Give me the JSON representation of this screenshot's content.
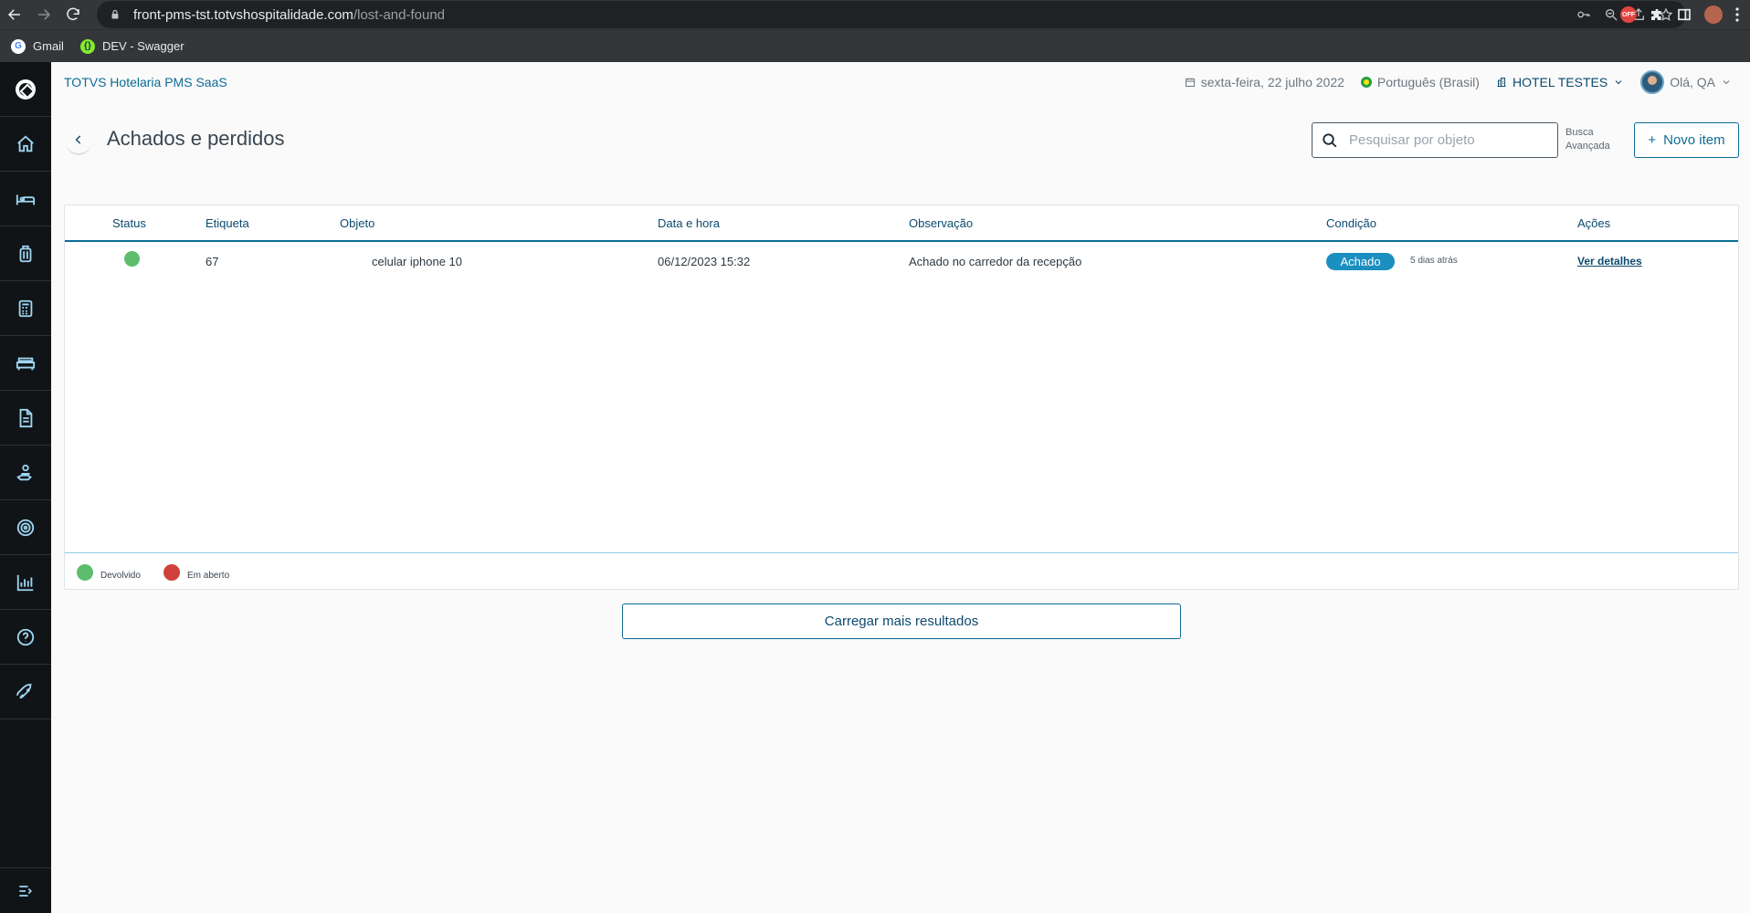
{
  "browser": {
    "url_host": "front-pms-tst.totvshospitalidade.com",
    "url_path": "/lost-and-found",
    "bookmarks": [
      {
        "label": "Gmail"
      },
      {
        "label": "DEV - Swagger"
      }
    ]
  },
  "app": {
    "title": "TOTVS Hotelaria PMS SaaS",
    "date": "sexta-feira, 22 julho 2022",
    "language": "Português (Brasil)",
    "hotel": "HOTEL TESTES",
    "greeting": "Olá, QA"
  },
  "page": {
    "title": "Achados e perdidos",
    "search_placeholder": "Pesquisar por objeto",
    "advanced_search": "Busca Avançada",
    "new_item": "Novo item",
    "load_more": "Carregar mais resultados"
  },
  "table": {
    "headers": {
      "status": "Status",
      "tag": "Etiqueta",
      "object": "Objeto",
      "datetime": "Data e hora",
      "note": "Observação",
      "condition": "Condição",
      "actions": "Ações"
    },
    "rows": [
      {
        "status_color": "#5dbd6d",
        "tag": "67",
        "object": "celular iphone 10",
        "datetime": "06/12/2023 15:32",
        "note": "Achado no carredor da recepção",
        "condition": "Achado",
        "ago": "5 dias atrás",
        "action": "Ver detalhes"
      }
    ]
  },
  "legend": [
    {
      "label": "Devolvido",
      "color": "#5dbd6d"
    },
    {
      "label": "Em aberto",
      "color": "#d0413b"
    }
  ],
  "colors": {
    "primary": "#0c6c94",
    "sidebar": "#101417",
    "badge": "#1a8fc0"
  }
}
